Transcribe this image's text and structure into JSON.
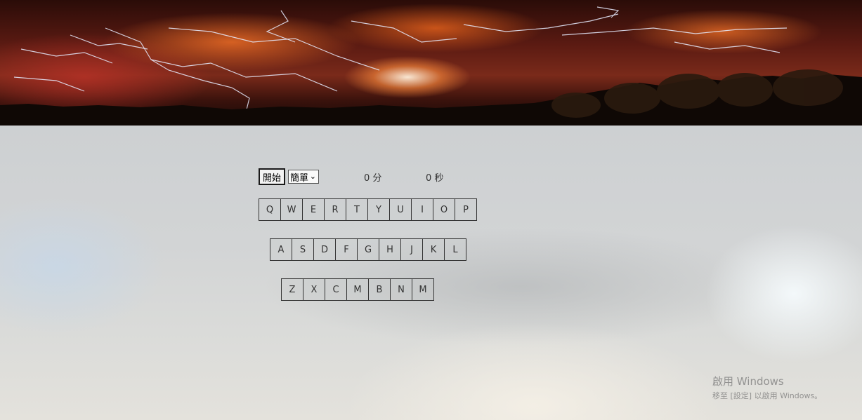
{
  "controls": {
    "start_label": "開始",
    "difficulty_selected": "簡單",
    "score_text": "0 分",
    "timer_text": "0 秒"
  },
  "keyboard": {
    "row1": [
      "Q",
      "W",
      "E",
      "R",
      "T",
      "Y",
      "U",
      "I",
      "O",
      "P"
    ],
    "row2": [
      "A",
      "S",
      "D",
      "F",
      "G",
      "H",
      "J",
      "K",
      "L"
    ],
    "row3": [
      "Z",
      "X",
      "C",
      "M",
      "B",
      "N",
      "M"
    ]
  },
  "watermark": {
    "title": "啟用 Windows",
    "subtitle": "移至 [設定] 以啟用 Windows。"
  }
}
